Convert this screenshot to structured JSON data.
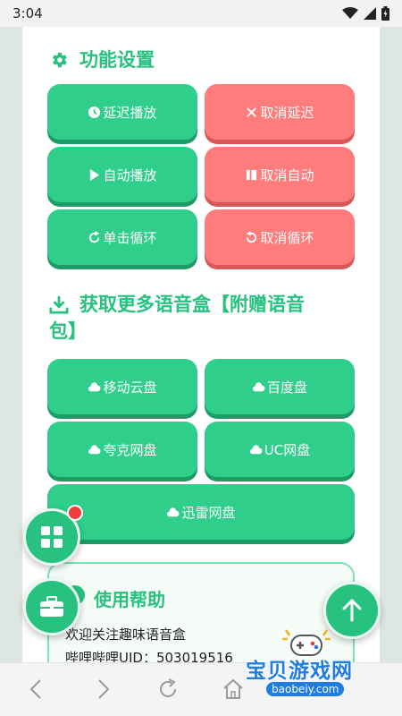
{
  "status_bar": {
    "time": "3:04"
  },
  "sections": {
    "settings_title": "功能设置",
    "download_title_line1": "获取更多语音盒【附赠语音",
    "download_title_line2": "包】",
    "help_title": "使用帮助"
  },
  "settings_buttons": {
    "delay_play": "延迟播放",
    "cancel_delay": "取消延迟",
    "auto_play": "自动播放",
    "cancel_auto": "取消自动",
    "single_loop": "单击循环",
    "cancel_loop": "取消循环"
  },
  "download_buttons": {
    "mobile_cloud": "移动云盘",
    "baidu_disk": "百度盘",
    "quark_disk": "夸克网盘",
    "uc_disk": "UC网盘",
    "xunlei_disk": "迅雷网盘"
  },
  "help": {
    "line1": "欢迎关注趣味语音盒",
    "line2": "哔哩哔哩UID：503019516"
  },
  "watermark": {
    "text": "宝贝游戏网",
    "url": "baobeiy.com"
  },
  "colors": {
    "accent": "#27c27f",
    "button_green": "#2fce8b",
    "button_red": "#ff7c7c",
    "badge_red": "#f03c3c"
  }
}
